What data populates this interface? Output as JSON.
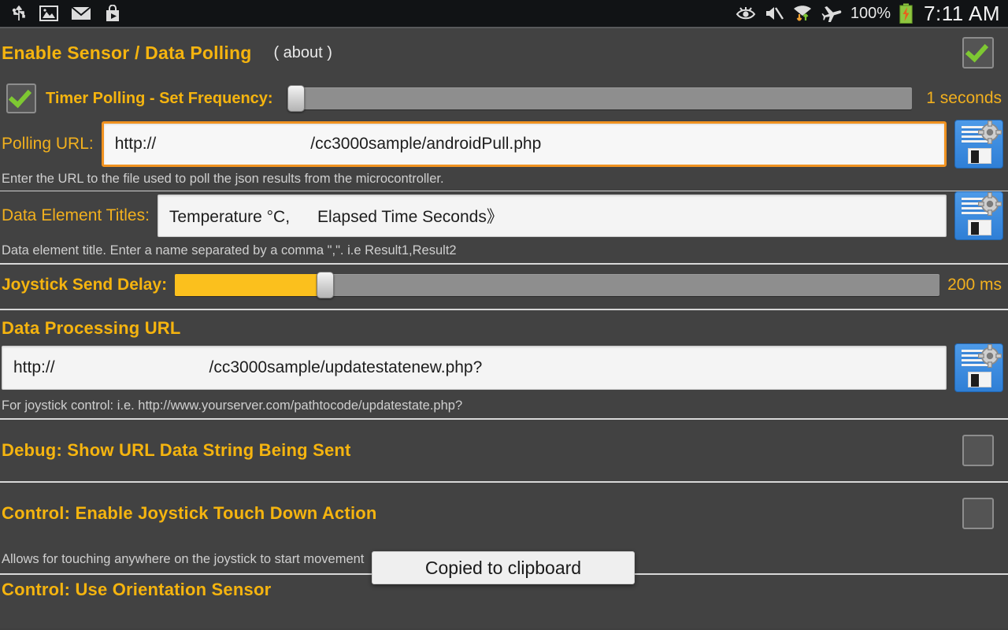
{
  "statusbar": {
    "left_icons": [
      "usb-icon",
      "screenshot-image-icon",
      "email-icon",
      "play-store-icon"
    ],
    "right_icons": [
      "eye-icon",
      "volume-muted-icon",
      "wifi-icon",
      "airplane-mode-icon"
    ],
    "battery_percent": "100%",
    "battery_icon": "battery-charging-icon",
    "clock": "7:11 AM"
  },
  "sensor_section": {
    "title": "Enable Sensor / Data Polling",
    "about_label": "( about )",
    "enabled": true
  },
  "timer_polling": {
    "label": "Timer Polling - Set Frequency:",
    "enabled": true,
    "value_label": "1 seconds",
    "slider_percent": 0
  },
  "polling_url": {
    "label": "Polling URL:",
    "protocol": "http://",
    "host": "",
    "path": "/cc3000sample/androidPull.php",
    "hint": "Enter the URL to the file used to poll the json results from the microcontroller.",
    "save_icon": "save-floppy-gear-icon"
  },
  "data_element_titles": {
    "label": "Data Element Titles:",
    "value": "Temperature °C,      Elapsed Time Seconds》",
    "hint": "Data element title.  Enter a name separated by a comma \",\".  i.e Result1,Result2",
    "save_icon": "save-floppy-gear-icon"
  },
  "joystick_delay": {
    "label": "Joystick Send Delay:",
    "value_label": "200 ms",
    "slider_percent": 20
  },
  "data_processing_url": {
    "title": "Data Processing URL",
    "protocol": "http://",
    "host": "",
    "path": "/cc3000sample/updatestatenew.php?",
    "hint": "For joystick control:  i.e. http://www.yourserver.com/pathtocode/updatestate.php?",
    "save_icon": "save-floppy-gear-icon"
  },
  "debug_section": {
    "title": "Debug: Show URL Data String Being Sent",
    "enabled": false
  },
  "joystick_touch_section": {
    "title": "Control:  Enable Joystick Touch Down Action",
    "hint": "Allows for touching anywhere on the joystick to start movement",
    "enabled": false
  },
  "orientation_section": {
    "title": "Control:  Use Orientation Sensor"
  },
  "toast": {
    "message": "Copied to clipboard"
  },
  "colors": {
    "accent_gold": "#f5b40f",
    "background": "#424242",
    "focus_orange": "#f09220",
    "check_green": "#7ec832",
    "slider_fill": "#fbc01d"
  }
}
